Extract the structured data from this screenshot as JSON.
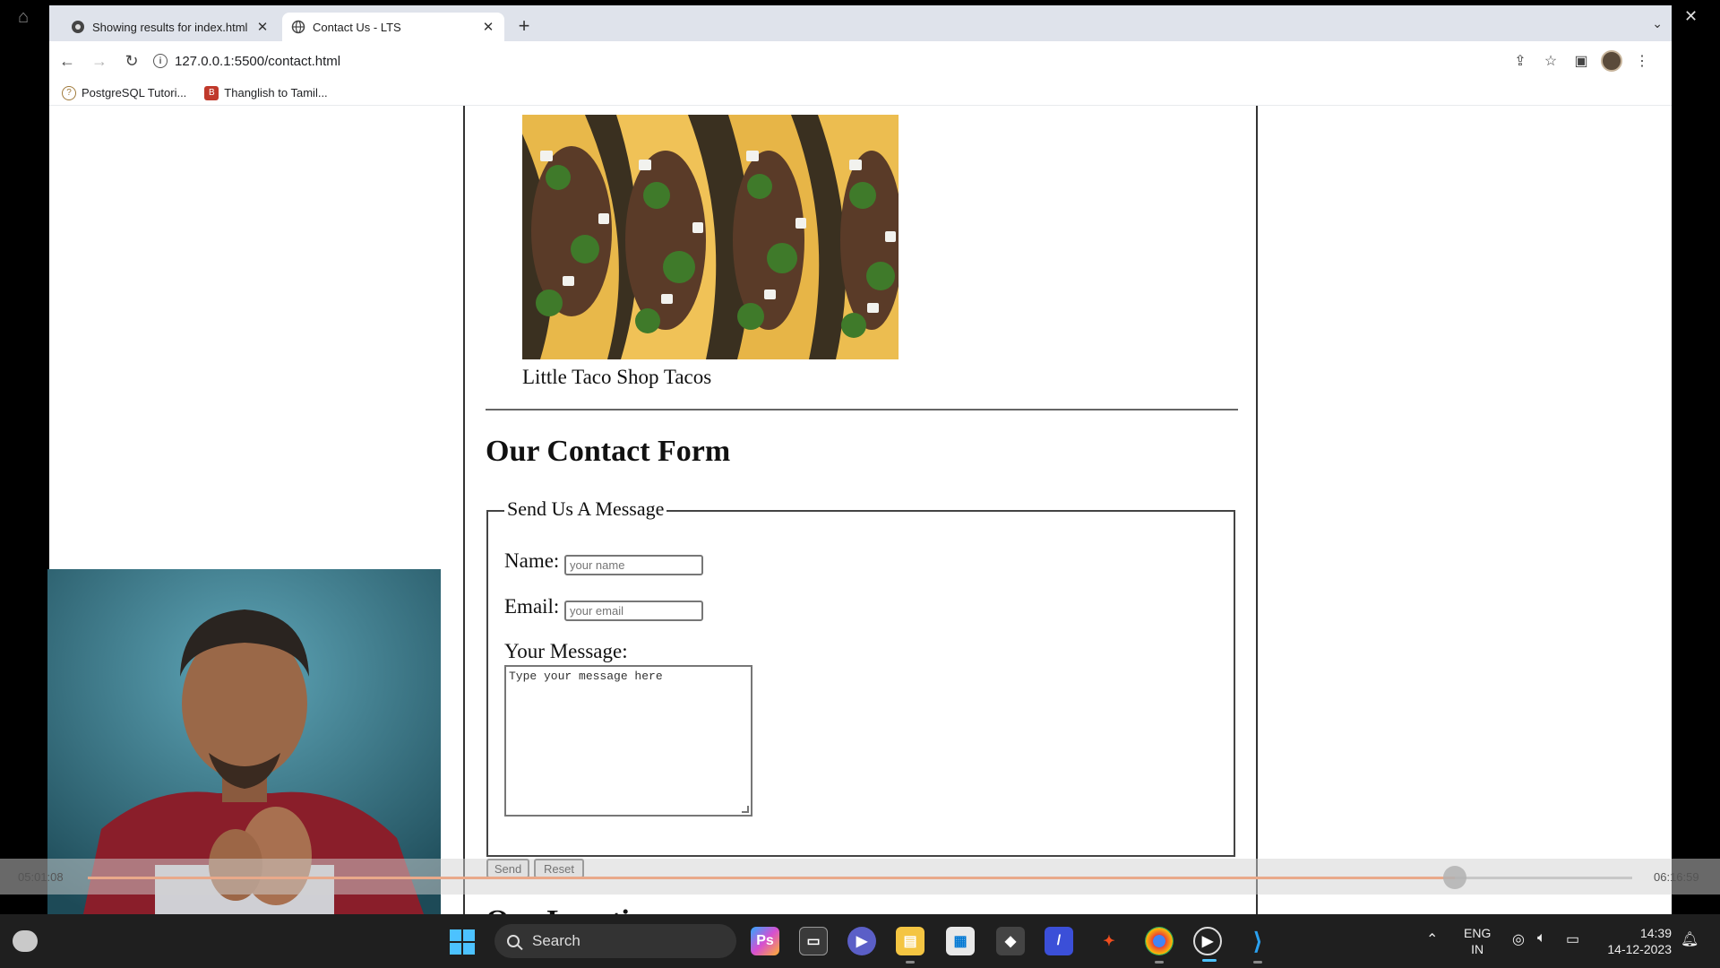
{
  "browser": {
    "tabs": [
      {
        "title": "Showing results for index.html",
        "active": false
      },
      {
        "title": "Contact Us - LTS",
        "active": true
      }
    ],
    "url": "127.0.0.1:5500/contact.html",
    "bookmarks": [
      {
        "label": "PostgreSQL Tutori..."
      },
      {
        "label": "Thanglish to Tamil..."
      }
    ]
  },
  "page": {
    "image_caption": "Little Taco Shop Tacos",
    "form_heading": "Our Contact Form",
    "legend": "Send Us A Message",
    "name_label": "Name:",
    "name_placeholder": "your name",
    "email_label": "Email:",
    "email_placeholder": "your email",
    "message_label": "Your Message:",
    "message_placeholder": "Type your message here",
    "send_label": "Send",
    "reset_label": "Reset",
    "next_heading": "Our Location"
  },
  "video": {
    "current_time": "05:01:08",
    "total_time": "06:16:59",
    "progress": 0.885,
    "colors": {
      "progress": "#e9a98a"
    }
  },
  "taskbar": {
    "search_label": "Search",
    "lang_top": "ENG",
    "lang_bottom": "IN",
    "time": "14:39",
    "date": "14-12-2023",
    "apps": [
      "photoshop-express-icon",
      "task-view-icon",
      "teams-icon",
      "file-explorer-icon",
      "ms-store-icon",
      "unity-icon",
      "affinity-icon",
      "figma-icon",
      "chrome-icon",
      "media-player-icon",
      "vscode-icon"
    ]
  }
}
